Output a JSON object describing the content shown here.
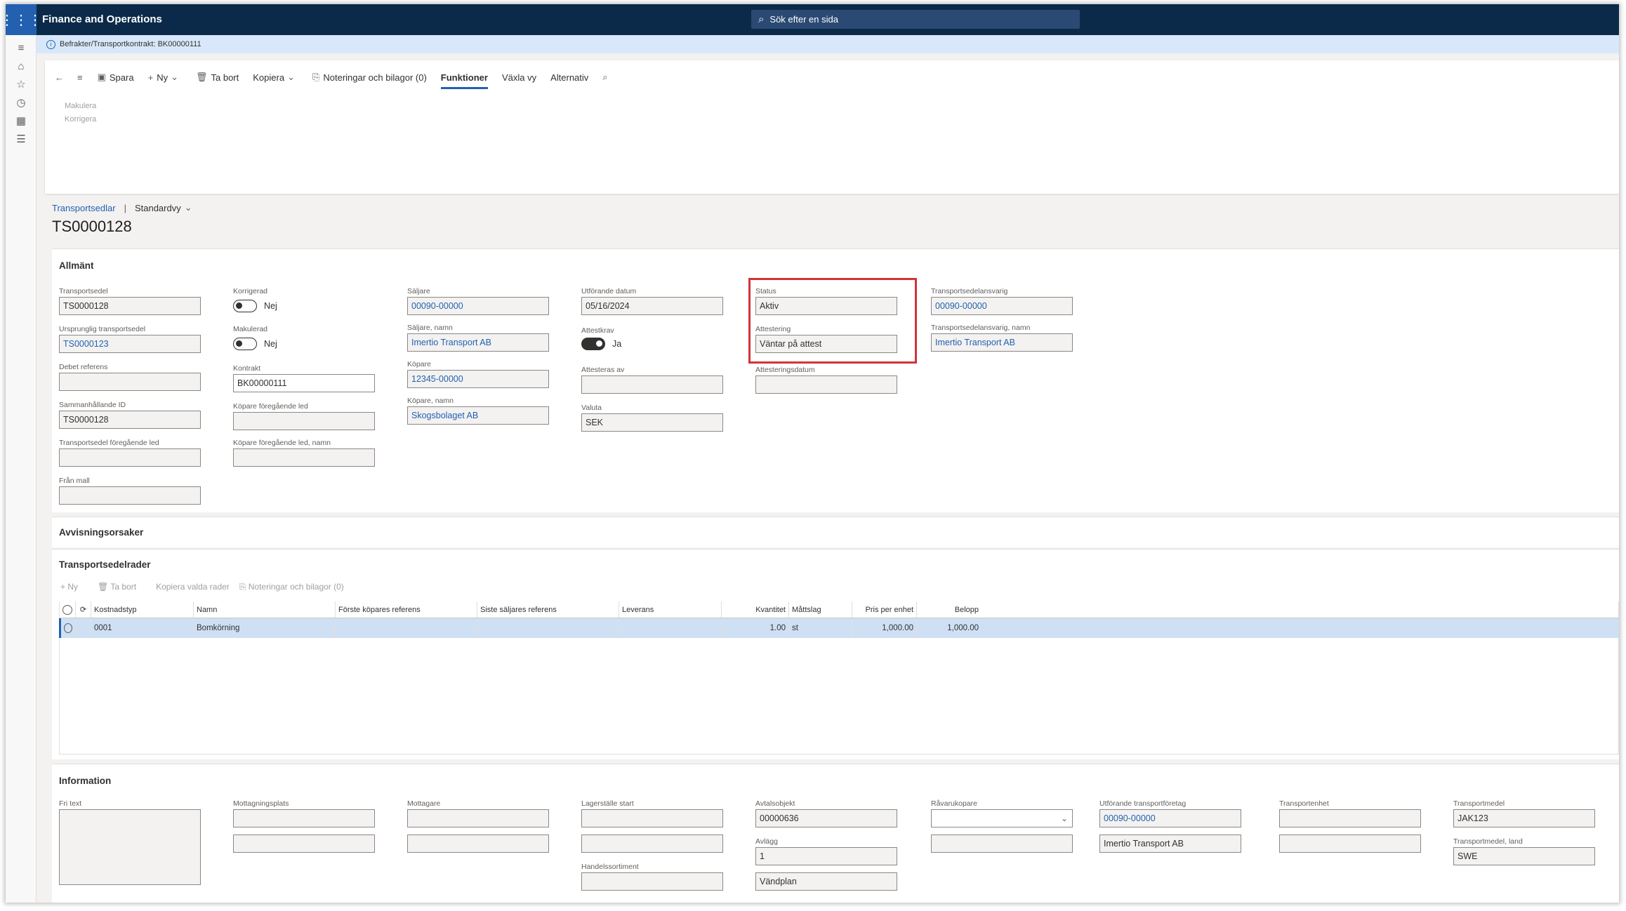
{
  "app": {
    "title": "Finance and Operations",
    "search_placeholder": "Sök efter en sida"
  },
  "infobar": {
    "text": "Befrakter/Transportkontrakt: BK00000111"
  },
  "toolbar": {
    "spara": "Spara",
    "ny": "Ny",
    "tabort": "Ta bort",
    "kopiera": "Kopiera",
    "noteringar": "Noteringar och bilagor (0)",
    "funktioner": "Funktioner",
    "vaxlavy": "Växla vy",
    "alternativ": "Alternativ"
  },
  "submenu": {
    "makulera": "Makulera",
    "korrigera": "Korrigera"
  },
  "breadcrumb": {
    "link": "Transportsedlar",
    "sep": "|",
    "view": "Standardvy"
  },
  "page_title": "TS0000128",
  "allmant": {
    "header": "Allmänt",
    "transportsedel_label": "Transportsedel",
    "transportsedel": "TS0000128",
    "ursprunglig_label": "Ursprunglig transportsedel",
    "ursprunglig": "TS0000123",
    "debet_label": "Debet referens",
    "debet": "",
    "sammanhallande_label": "Sammanhållande ID",
    "sammanhallande": "TS0000128",
    "tsforeg_label": "Transportsedel föregående led",
    "tsforeg": "",
    "franmall_label": "Från mall",
    "franmall": "",
    "korrigerad_label": "Korrigerad",
    "korrigerad": "Nej",
    "makulerad_label": "Makulerad",
    "makulerad": "Nej",
    "kontrakt_label": "Kontrakt",
    "kontrakt": "BK00000111",
    "kopforeg_label": "Köpare föregående led",
    "kopforeg": "",
    "kopforegnamn_label": "Köpare föregående led, namn",
    "kopforegnamn": "",
    "saljare_label": "Säljare",
    "saljare": "00090-00000",
    "saljarenamn_label": "Säljare, namn",
    "saljarenamn": "Imertio Transport AB",
    "kopare_label": "Köpare",
    "kopare": "12345-00000",
    "koparenamn_label": "Köpare, namn",
    "koparenamn": "Skogsbolaget AB",
    "utfdatum_label": "Utförande datum",
    "utfdatum": "05/16/2024",
    "attestkrav_label": "Attestkrav",
    "attestkrav": "Ja",
    "attesterasav_label": "Attesteras av",
    "attesterasav": "",
    "valuta_label": "Valuta",
    "valuta": "SEK",
    "status_label": "Status",
    "status": "Aktiv",
    "attestering_label": "Attestering",
    "attestering": "Väntar på attest",
    "attesteringsdatum_label": "Attesteringsdatum",
    "attesteringsdatum": "",
    "tsansvarig_label": "Transportsedelansvarig",
    "tsansvarig": "00090-00000",
    "tsansvarignamn_label": "Transportsedelansvarig, namn",
    "tsansvarignamn": "Imertio Transport AB"
  },
  "avvisning": {
    "header": "Avvisningsorsaker"
  },
  "rader": {
    "header": "Transportsedelrader",
    "toolbar": {
      "ny": "Ny",
      "tabort": "Ta bort",
      "kopiera": "Kopiera valda rader",
      "noteringar": "Noteringar och bilagor (0)"
    },
    "columns": {
      "kostnadstyp": "Kostnadstyp",
      "namn": "Namn",
      "forste": "Förste köpares referens",
      "siste": "Siste säljares referens",
      "leverans": "Leverans",
      "kvantitet": "Kvantitet",
      "mattslag": "Måttslag",
      "pris": "Pris per enhet",
      "belopp": "Belopp"
    },
    "rows": [
      {
        "kostnadstyp": "0001",
        "namn": "Bomkörning",
        "forste": "",
        "siste": "",
        "leverans": "",
        "kvantitet": "1.00",
        "mattslag": "st",
        "pris": "1,000.00",
        "belopp": "1,000.00"
      }
    ]
  },
  "information": {
    "header": "Information",
    "fritext_label": "Fri text",
    "fritext": "",
    "mottagningsplats_label": "Mottagningsplats",
    "mottagningsplats": "",
    "mottagningsplats2": "",
    "mottagare_label": "Mottagare",
    "mottagare": "",
    "mottagare2": "",
    "lagerstalle_label": "Lagerställe start",
    "lagerstalle": "",
    "lagerstalle2": "",
    "handelssortiment_label": "Handelssortiment",
    "handelssortiment": "",
    "avtalsobjekt_label": "Avtalsobjekt",
    "avtalsobjekt": "00000636",
    "avlagg_label": "Avlägg",
    "avlagg": "1",
    "avlagg2": "Vändplan",
    "ravarukopare_label": "Råvarukopare",
    "ravarukopare": "",
    "ravarukopare2": "",
    "utftransport_label": "Utförande transportföretag",
    "utftransport": "00090-00000",
    "utftransport2": "Imertio Transport AB",
    "transportenhet_label": "Transportenhet",
    "transportenhet": "",
    "transportenhet2": "",
    "transportmedel_label": "Transportmedel",
    "transportmedel": "JAK123",
    "transportmedelland_label": "Transportmedel, land",
    "transportmedelland": "SWE"
  },
  "colors": {
    "topbar": "#0b2a4a",
    "accent": "#2361b0",
    "highlight": "#d13438",
    "selected_row": "#cfe0f5"
  }
}
